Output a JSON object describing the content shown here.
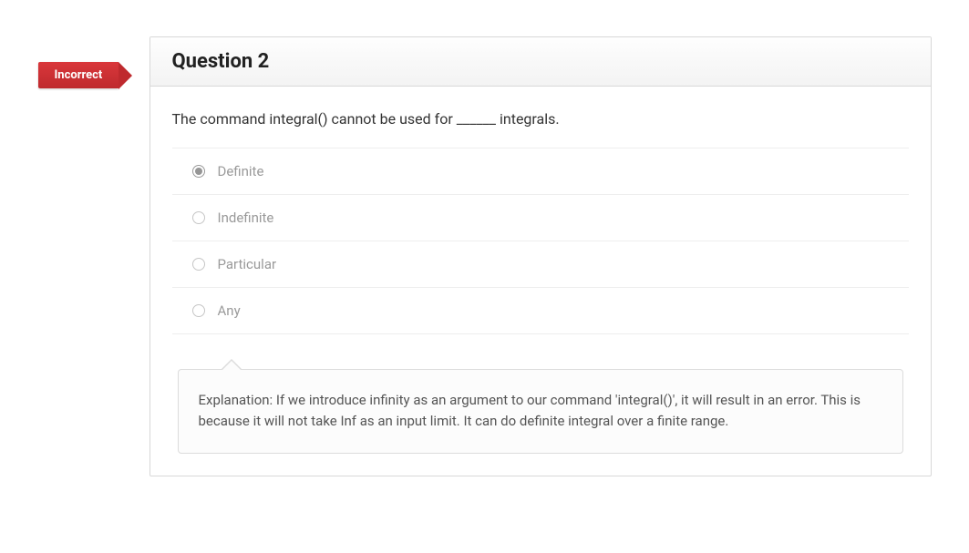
{
  "badge": {
    "label": "Incorrect"
  },
  "question": {
    "title": "Question 2",
    "prompt": "The command integral() cannot be used for ______ integrals.",
    "options": [
      {
        "label": "Definite",
        "selected": true
      },
      {
        "label": "Indefinite",
        "selected": false
      },
      {
        "label": "Particular",
        "selected": false
      },
      {
        "label": "Any",
        "selected": false
      }
    ],
    "explanation": "Explanation: If we introduce infinity as an argument to our command 'integral()', it will result in an error. This is because it will not take Inf as an input limit. It can do definite integral over a finite range."
  }
}
